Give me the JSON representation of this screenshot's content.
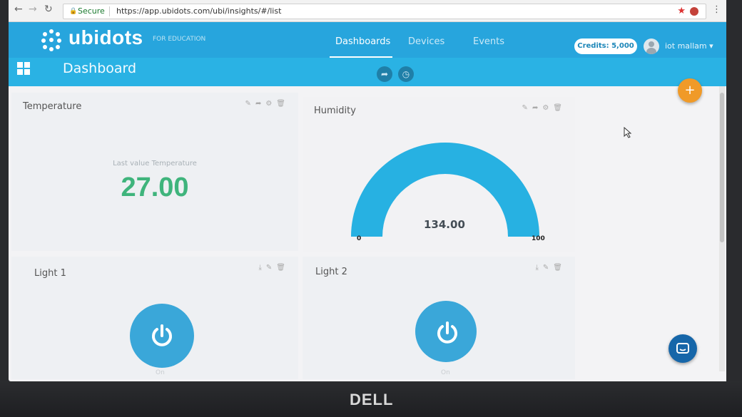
{
  "browser": {
    "secure_label": "Secure",
    "url": "https://app.ubidots.com/ubi/insights/#/list"
  },
  "header": {
    "logo_text": "ubidots",
    "logo_sub": "FOR EDUCATION",
    "tabs": [
      {
        "label": "Dashboards",
        "active": true
      },
      {
        "label": "Devices",
        "active": false
      },
      {
        "label": "Events",
        "active": false
      }
    ],
    "credits": "Credits: 5,000",
    "user_name": "iot mallam",
    "brand_color": "#27a5dd"
  },
  "dashboard": {
    "title": "Dashboard",
    "widgets": {
      "temperature": {
        "title": "Temperature",
        "caption": "Last value Temperature",
        "value": "27.00",
        "value_color": "#3fb47c"
      },
      "humidity": {
        "title": "Humidity",
        "value": "134.00",
        "min": "0",
        "max": "100",
        "fill_fraction": 1.0,
        "gauge_color": "#27b1e2"
      },
      "light1": {
        "title": "Light 1",
        "state": "On"
      },
      "light2": {
        "title": "Light 2",
        "state": "On"
      }
    }
  },
  "footer": {
    "brand": "DELL"
  }
}
